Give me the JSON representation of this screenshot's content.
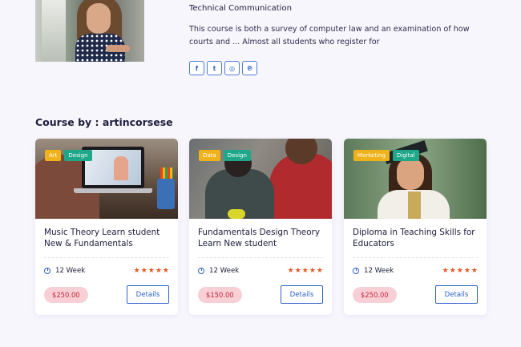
{
  "author": {
    "role": "Technical Communication",
    "bio": "This course is both a survey of computer law and an examination of how courts and ... Almost all students who register for",
    "socials": [
      {
        "icon": "facebook-icon",
        "glyph": "f"
      },
      {
        "icon": "twitter-icon",
        "glyph": "t"
      },
      {
        "icon": "instagram-icon",
        "glyph": "◎"
      },
      {
        "icon": "pinterest-icon",
        "glyph": "℗"
      }
    ]
  },
  "section": {
    "title": "Course by : artincorsese"
  },
  "courses": [
    {
      "tags": [
        {
          "label": "Art",
          "color": "#f0b21a"
        },
        {
          "label": "Design",
          "color": "#1fa78a"
        }
      ],
      "title": "Music Theory Learn student New & Fundamentals",
      "duration": "12 Week",
      "rating_stars": 5,
      "price": "$250.00",
      "details_label": "Details"
    },
    {
      "tags": [
        {
          "label": "Data",
          "color": "#f0b21a"
        },
        {
          "label": "Design",
          "color": "#1fa78a"
        }
      ],
      "title": "Fundamentals Design Theory Learn New student",
      "duration": "12 Week",
      "rating_stars": 5,
      "price": "$150.00",
      "details_label": "Details"
    },
    {
      "tags": [
        {
          "label": "Marketing",
          "color": "#f0b21a"
        },
        {
          "label": "Digital",
          "color": "#1fa78a"
        }
      ],
      "title": "Diploma in Teaching Skills for Educators",
      "duration": "12 Week",
      "rating_stars": 5,
      "price": "$250.00",
      "details_label": "Details"
    }
  ],
  "colors": {
    "accent_blue": "#2f62c9",
    "star_orange": "#e8531d",
    "price_bg": "#f8cfd5",
    "tag_yellow": "#f0b21a",
    "tag_green": "#1fa78a"
  }
}
